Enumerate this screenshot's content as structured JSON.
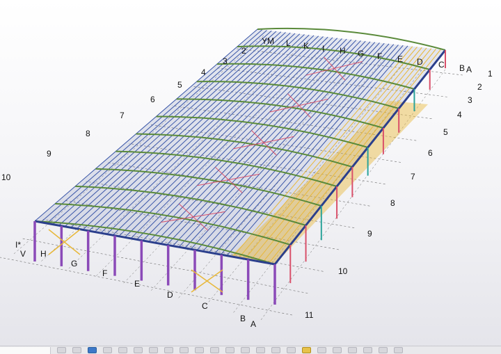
{
  "viewport": {
    "background_top": "#ffffff",
    "background_bottom": "#e4e4ea",
    "near_edge_labels": [
      "A",
      "B",
      "C",
      "D",
      "E",
      "F",
      "G",
      "H",
      "V",
      "I*"
    ],
    "far_edge_labels": [
      "YM",
      "L",
      "K",
      "I",
      "H",
      "G",
      "F",
      "E",
      "D",
      "C",
      "B",
      "A"
    ],
    "left_axis_labels": [
      "2",
      "3",
      "4",
      "5",
      "6",
      "7",
      "8",
      "9",
      "10"
    ],
    "right_axis_labels": [
      "1",
      "2",
      "3",
      "4",
      "5",
      "6",
      "7",
      "8",
      "9",
      "10",
      "11"
    ],
    "colors": {
      "column": "#8b4ab8",
      "beam": "#2b3f8c",
      "purlin": "#3a56a8",
      "rafter": "#5a8a3a",
      "brace": "#d9506a",
      "highlight": "#e8b83a",
      "teal": "#2aa39a",
      "gridline": "#6a6a6a"
    }
  },
  "toolbar": {
    "buttons": [
      {
        "icon": "pointer-icon"
      },
      {
        "icon": "pointer-icon"
      },
      {
        "icon": "select-icon",
        "accent": true
      },
      {
        "icon": "grid-icon"
      },
      {
        "icon": "link-icon"
      },
      {
        "icon": "edit-icon"
      },
      {
        "icon": "circle-icon"
      },
      {
        "icon": "copy-icon"
      },
      {
        "icon": "copy-icon"
      },
      {
        "icon": "pointer-icon"
      },
      {
        "icon": "pointer-icon"
      },
      {
        "icon": "save-icon"
      },
      {
        "icon": "pointer-icon"
      },
      {
        "icon": "pointer-icon"
      },
      {
        "icon": "pointer-icon"
      },
      {
        "icon": "pointer-icon"
      },
      {
        "icon": "layer-icon",
        "warn": true
      },
      {
        "icon": "layer-icon"
      },
      {
        "icon": "layer-icon"
      },
      {
        "icon": "layer-icon"
      },
      {
        "icon": "layer-icon"
      },
      {
        "icon": "layer-icon"
      },
      {
        "icon": "layer-icon"
      }
    ]
  }
}
